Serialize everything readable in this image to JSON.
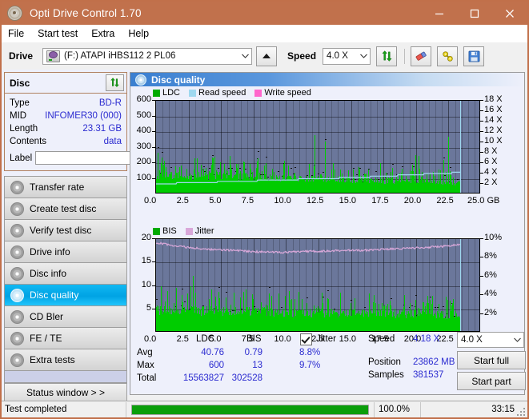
{
  "window": {
    "title": "Opti Drive Control 1.70",
    "icon": "disc-icon",
    "minimize": "minimize-icon",
    "maximize": "maximize-icon",
    "close": "close-icon"
  },
  "menu": {
    "items": [
      "File",
      "Start test",
      "Extra",
      "Help"
    ]
  },
  "toolbar": {
    "drive_label": "Drive",
    "drive_value": "(F:)  ATAPI iHBS112  2 PL06",
    "eject": "eject-icon",
    "speed_label": "Speed",
    "speed_value": "4.0 X",
    "refresh": "refresh-icon",
    "erase": "eraser-icon",
    "tools": "wrench-icon",
    "save": "save-icon"
  },
  "disc": {
    "title": "Disc",
    "refresh": "refresh-icon",
    "rows": [
      {
        "key": "Type",
        "value": "BD-R"
      },
      {
        "key": "MID",
        "value": "INFOMER30 (000)"
      },
      {
        "key": "Length",
        "value": "23.31 GB"
      },
      {
        "key": "Contents",
        "value": "data"
      }
    ],
    "label_key": "Label",
    "label_value": "",
    "label_placeholder": ""
  },
  "nav": {
    "items": [
      {
        "label": "Transfer rate",
        "active": false
      },
      {
        "label": "Create test disc",
        "active": false
      },
      {
        "label": "Verify test disc",
        "active": false
      },
      {
        "label": "Drive info",
        "active": false
      },
      {
        "label": "Disc info",
        "active": false
      },
      {
        "label": "Disc quality",
        "active": true
      },
      {
        "label": "CD Bler",
        "active": false
      },
      {
        "label": "FE / TE",
        "active": false
      },
      {
        "label": "Extra tests",
        "active": false
      }
    ],
    "status_window": "Status window > >"
  },
  "panel": {
    "title": "Disc quality",
    "icon": "disc-quality-icon"
  },
  "stats": {
    "col_ldc": "LDC",
    "col_bis": "BIS",
    "rows": [
      {
        "label": "Avg",
        "ldc": "40.76",
        "bis": "0.79",
        "jitter": "8.8%"
      },
      {
        "label": "Max",
        "ldc": "600",
        "bis": "13",
        "jitter": "9.7%"
      },
      {
        "label": "Total",
        "ldc": "15563827",
        "bis": "302528",
        "jitter": ""
      }
    ],
    "jitter_label": "Jitter",
    "jitter_checked": true,
    "speed_label": "Speed",
    "speed_value": "4.18 X",
    "position_label": "Position",
    "position_value": "23862 MB",
    "samples_label": "Samples",
    "samples_value": "381537",
    "speed_select": "4.0 X",
    "start_full": "Start full",
    "start_part": "Start part"
  },
  "statusbar": {
    "text": "Test completed",
    "percent": "100.0%",
    "progress": 100,
    "time": "33:15"
  },
  "colors": {
    "accent": "#c1714c",
    "ldc": "#00cc00",
    "bis": "#00cc00",
    "read_speed": "#9fd8ef",
    "write_speed": "#ff66cc",
    "jitter": "#d9a8d9",
    "plot_bg": "#6b779b",
    "value_text": "#2b2bd0",
    "progress": "#0a9e0a"
  },
  "chart_data": [
    {
      "type": "bar",
      "name": "ldc-chart",
      "title": "",
      "legend": [
        {
          "label": "LDC",
          "color": "#00aa00"
        },
        {
          "label": "Read speed",
          "color": "#9fd8ef"
        },
        {
          "label": "Write speed",
          "color": "#ff66cc"
        }
      ],
      "legend_position": "top-left",
      "xlabel": "GB",
      "x_ticks": [
        "0.0",
        "2.5",
        "5.0",
        "7.5",
        "10.0",
        "12.5",
        "15.0",
        "17.5",
        "20.0",
        "22.5",
        "25.0"
      ],
      "xlim": [
        0,
        25
      ],
      "ylabel_left": "LDC",
      "y_ticks_left": [
        100,
        200,
        300,
        400,
        500,
        600
      ],
      "ylim_left": [
        0,
        600
      ],
      "ylabel_right": "Speed",
      "y_ticks_right": [
        "2 X",
        "4 X",
        "6 X",
        "8 X",
        "10 X",
        "12 X",
        "14 X",
        "16 X",
        "18 X"
      ],
      "ylim_right": [
        0,
        18
      ],
      "grid": true,
      "data_end_gb": 23.4,
      "series": [
        {
          "name": "LDC",
          "type": "bar",
          "color": "#00cc00",
          "x": [
            0.1,
            0.2,
            0.3,
            0.4,
            0.5,
            0.6,
            0.7,
            0.8,
            0.9,
            1.0,
            1.2,
            1.4,
            1.6,
            1.8,
            2.0,
            2.2,
            2.4,
            2.6,
            2.8,
            3.0,
            3.3,
            3.6,
            3.9,
            4.2,
            4.5,
            4.8,
            5.1,
            5.4,
            5.7,
            6.0,
            6.4,
            6.8,
            7.2,
            7.6,
            8.0,
            8.4,
            8.8,
            9.2,
            9.6,
            10.0,
            10.5,
            11.0,
            11.5,
            12.0,
            12.5,
            13.0,
            13.5,
            14.0,
            14.5,
            15.0,
            15.5,
            16.0,
            16.5,
            17.0,
            17.5,
            18.0,
            18.5,
            19.0,
            19.5,
            20.0,
            20.5,
            21.0,
            21.5,
            22.0,
            22.5,
            23.0,
            23.3
          ],
          "values": [
            300,
            430,
            560,
            250,
            210,
            330,
            200,
            190,
            260,
            180,
            170,
            230,
            200,
            185,
            195,
            175,
            160,
            190,
            300,
            180,
            165,
            200,
            175,
            160,
            170,
            155,
            150,
            390,
            220,
            165,
            150,
            175,
            160,
            150,
            300,
            160,
            150,
            310,
            180,
            150,
            145,
            140,
            150,
            420,
            380,
            560,
            150,
            140,
            500,
            160,
            300,
            150,
            330,
            420,
            160,
            150,
            140,
            145,
            150,
            420,
            180,
            160,
            260,
            200,
            460,
            600,
            200
          ]
        },
        {
          "name": "Read speed",
          "type": "line",
          "color": "#9fd8ef",
          "x": [
            0.0,
            2.5,
            5.0,
            7.5,
            10.0,
            12.5,
            15.0,
            17.5,
            20.0,
            22.5,
            23.4
          ],
          "values": [
            2.0,
            2.2,
            2.4,
            2.6,
            2.8,
            3.0,
            3.2,
            3.5,
            3.8,
            4.1,
            4.18
          ]
        },
        {
          "name": "Write speed",
          "type": "line",
          "color": "#ff66cc",
          "x": [],
          "values": []
        }
      ]
    },
    {
      "type": "bar",
      "name": "bis-chart",
      "title": "",
      "legend": [
        {
          "label": "BIS",
          "color": "#00aa00"
        },
        {
          "label": "Jitter",
          "color": "#d9a8d9"
        }
      ],
      "legend_position": "top-left",
      "xlabel": "GB",
      "x_ticks": [
        "0.0",
        "2.5",
        "5.0",
        "7.5",
        "10.0",
        "12.5",
        "15.0",
        "17.5",
        "20.0",
        "22.5",
        "25.0"
      ],
      "xlim": [
        0,
        25
      ],
      "ylabel_left": "BIS",
      "y_ticks_left": [
        5,
        10,
        15,
        20
      ],
      "ylim_left": [
        0,
        20
      ],
      "ylabel_right": "Jitter",
      "y_ticks_right": [
        "2%",
        "4%",
        "6%",
        "8%",
        "10%"
      ],
      "ylim_right": [
        0,
        10
      ],
      "grid": true,
      "data_end_gb": 23.4,
      "series": [
        {
          "name": "BIS",
          "type": "bar",
          "color": "#00cc00",
          "x": [
            0.1,
            0.2,
            0.3,
            0.4,
            0.5,
            0.6,
            0.7,
            0.8,
            0.9,
            1.0,
            1.2,
            1.4,
            1.6,
            1.8,
            2.0,
            2.2,
            2.4,
            2.6,
            2.8,
            3.0,
            3.3,
            3.6,
            3.9,
            4.2,
            4.5,
            4.8,
            5.1,
            5.4,
            5.7,
            6.0,
            6.4,
            6.8,
            7.2,
            7.6,
            8.0,
            8.4,
            8.8,
            9.2,
            9.6,
            10.0,
            10.5,
            11.0,
            11.5,
            12.0,
            12.5,
            13.0,
            13.5,
            14.0,
            14.5,
            15.0,
            15.5,
            16.0,
            16.5,
            17.0,
            17.5,
            18.0,
            18.5,
            19.0,
            19.5,
            20.0,
            20.5,
            21.0,
            21.5,
            22.0,
            22.5,
            23.0,
            23.3
          ],
          "values": [
            9,
            11,
            12,
            10,
            8,
            9,
            7,
            8,
            9,
            7,
            6,
            8,
            7,
            7,
            8,
            6,
            6,
            7,
            13,
            7,
            6,
            7,
            7,
            6,
            6,
            6,
            5,
            7,
            6,
            6,
            5,
            6,
            6,
            5,
            7,
            6,
            5,
            6,
            6,
            5,
            5,
            5,
            5,
            6,
            6,
            6,
            5,
            5,
            6,
            5,
            6,
            5,
            6,
            6,
            5,
            5,
            5,
            5,
            5,
            6,
            5,
            5,
            6,
            6,
            7,
            7,
            5
          ]
        },
        {
          "name": "Jitter",
          "type": "line",
          "color": "#d9a8d9",
          "x": [
            0.0,
            1.0,
            2.5,
            4.0,
            5.5,
            7.0,
            8.5,
            10.0,
            11.5,
            13.0,
            14.5,
            16.0,
            17.5,
            19.0,
            20.5,
            22.0,
            23.3
          ],
          "values": [
            9.6,
            9.4,
            9.1,
            8.9,
            8.8,
            8.7,
            8.6,
            8.6,
            8.7,
            8.7,
            8.8,
            8.8,
            8.9,
            9.0,
            9.1,
            9.2,
            9.4
          ]
        }
      ]
    }
  ]
}
